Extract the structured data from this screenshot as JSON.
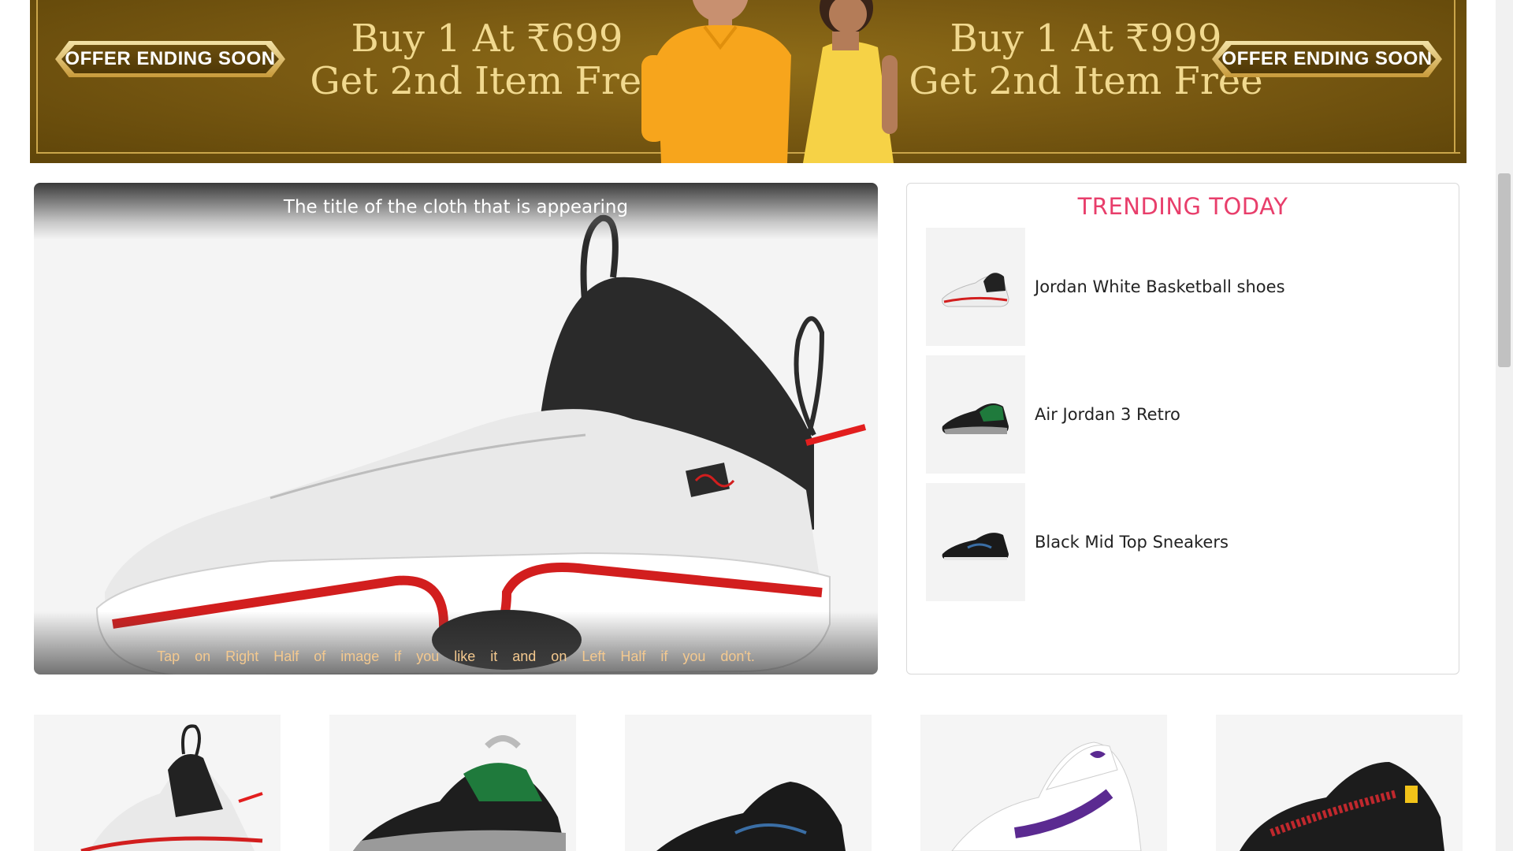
{
  "banner": {
    "offer_left": "OFFER ENDING SOON",
    "offer_right": "OFFER ENDING SOON",
    "promo_left_line1": "Buy 1 At ₹699",
    "promo_left_line2": "Get 2nd Item Free",
    "promo_right_line1": "Buy 1 At ₹999",
    "promo_right_line2": "Get 2nd Item Free",
    "colors": {
      "background": "#7a5a12",
      "text": "#f1d98f",
      "badge_text": "#ffffff"
    }
  },
  "swipe_card": {
    "title": "The title of the cloth that is appearing",
    "hint": "Tap on Right Half of image if you like it and on Left Half if you don't.",
    "image": "white-red-basketball-shoe"
  },
  "trending": {
    "title": "TRENDING TODAY",
    "title_color": "#e83e6b",
    "items": [
      {
        "name": "Jordan White Basketball shoes",
        "image": "white-basketball-shoe"
      },
      {
        "name": "Air Jordan 3 Retro",
        "image": "black-green-sneaker"
      },
      {
        "name": "Black Mid Top Sneakers",
        "image": "black-mid-top-sneaker"
      }
    ]
  },
  "products": [
    {
      "image": "white-red-basketball-shoe"
    },
    {
      "image": "black-green-cement-sneaker"
    },
    {
      "image": "black-mid-top-sneaker"
    },
    {
      "image": "white-purple-high-top"
    },
    {
      "image": "black-red-racing-shoe"
    }
  ]
}
